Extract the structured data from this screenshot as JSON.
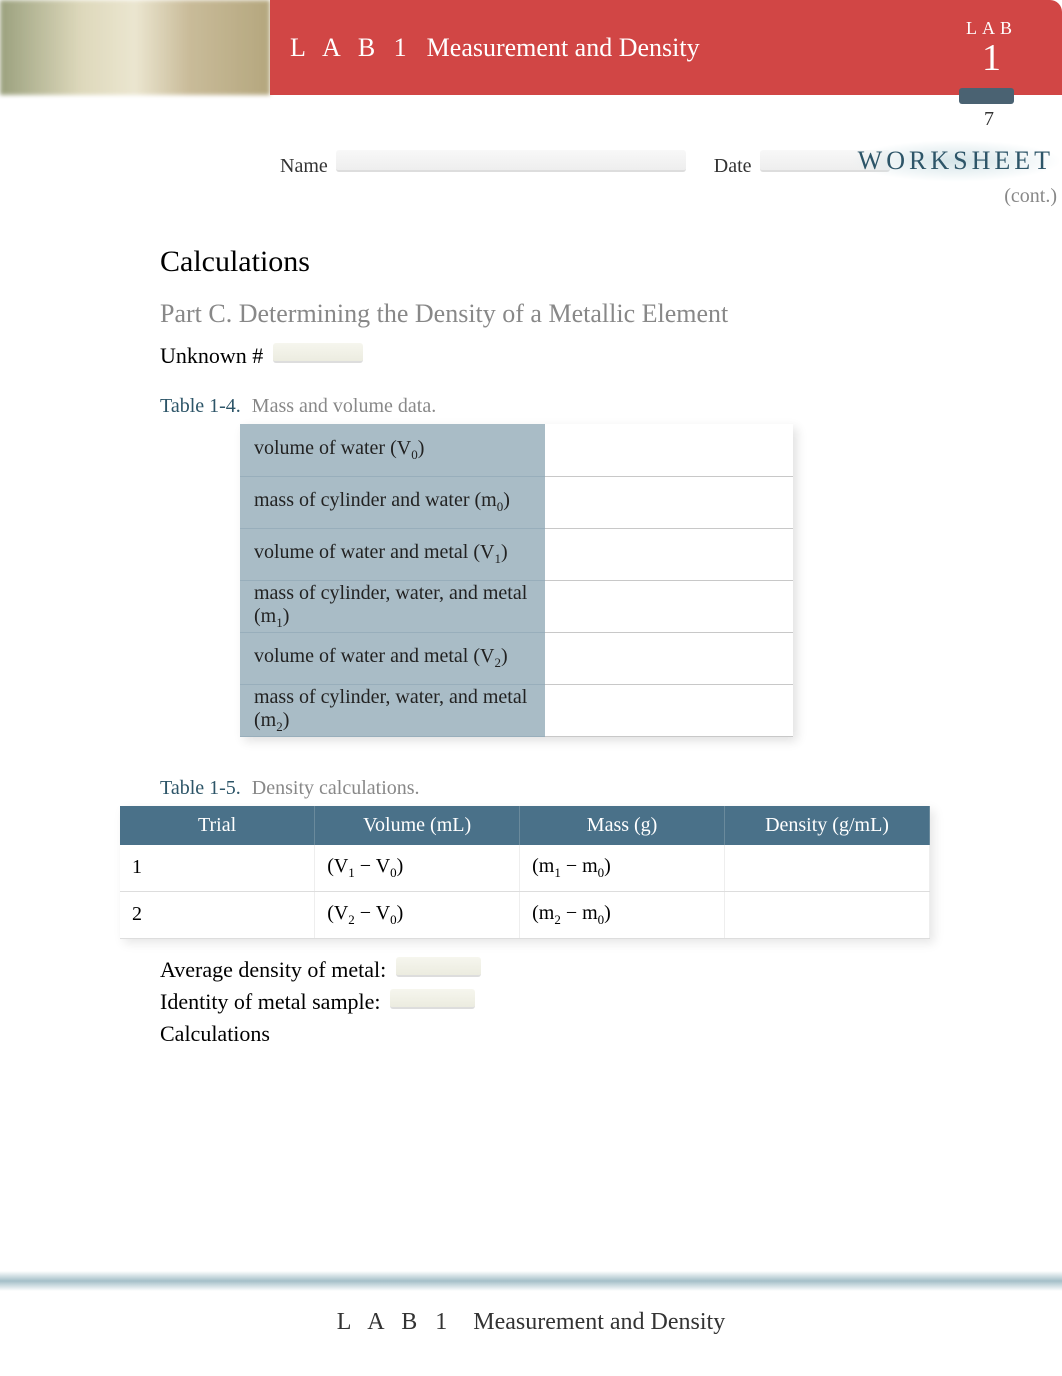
{
  "header": {
    "lab_prefix": "L A B 1",
    "title": "Measurement and Density",
    "right_lab": "LAB",
    "right_num": "1",
    "page_number": "7"
  },
  "meta": {
    "name_label": "Name",
    "date_label": "Date",
    "worksheet": "WORKSHEET",
    "cont": "(cont.)"
  },
  "body": {
    "calculations": "Calculations",
    "part_c": "Part C. Determining the Density of a Metallic Element",
    "unknown_label": "Unknown #"
  },
  "table14": {
    "num": "Table 1-4.",
    "desc": "Mass and volume data.",
    "rows": [
      {
        "label": "volume of water (",
        "var": "V",
        "sub": "0",
        "close": ")"
      },
      {
        "label": "mass of cylinder and water (",
        "var": "m",
        "sub": "0",
        "close": ")"
      },
      {
        "label": "volume of water and metal (",
        "var": "V",
        "sub": "1",
        "close": ")"
      },
      {
        "label": "mass of cylinder, water, and metal (",
        "var": "m",
        "sub": "1",
        "close": ")"
      },
      {
        "label": "volume of water and metal (",
        "var": "V",
        "sub": "2",
        "close": ")"
      },
      {
        "label": "mass of cylinder, water, and metal (",
        "var": "m",
        "sub": "2",
        "close": ")"
      }
    ]
  },
  "table15": {
    "num": "Table 1-5.",
    "desc": "Density calculations.",
    "headers": [
      "Trial",
      "Volume (mL)",
      "Mass (g)",
      "Density (g/mL)"
    ],
    "rows": [
      {
        "trial": "1",
        "vol_open": "(V",
        "vol_sub1": "1",
        "vol_mid": " − V",
        "vol_sub2": "0",
        "vol_close": ")",
        "mass_open": "(m",
        "mass_sub1": "1",
        "mass_mid": " − m",
        "mass_sub2": "0",
        "mass_close": ")"
      },
      {
        "trial": "2",
        "vol_open": "(V",
        "vol_sub1": "2",
        "vol_mid": " − V",
        "vol_sub2": "0",
        "vol_close": ")",
        "mass_open": "(m",
        "mass_sub1": "2",
        "mass_mid": " − m",
        "mass_sub2": "0",
        "mass_close": ")"
      }
    ]
  },
  "results": {
    "avg_density": "Average density of metal:",
    "identity": "Identity of metal sample:",
    "calculations": "Calculations"
  },
  "footer": {
    "lab_prefix": "L A B 1",
    "title": "Measurement and Density"
  }
}
